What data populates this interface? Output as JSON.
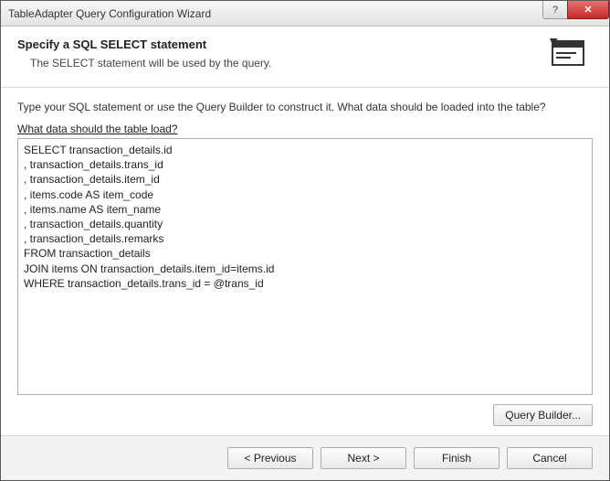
{
  "titlebar": {
    "title": "TableAdapter Query Configuration Wizard",
    "help_glyph": "?",
    "close_glyph": "✕"
  },
  "header": {
    "title": "Specify a SQL SELECT statement",
    "subtitle": "The SELECT statement will be used by the query."
  },
  "body": {
    "instruction": "Type your SQL statement or use the Query Builder to construct it. What data should be loaded into the table?",
    "field_label": "What data should the table load?",
    "sql_text": "SELECT transaction_details.id\n, transaction_details.trans_id\n, transaction_details.item_id\n, items.code AS item_code\n, items.name AS item_name\n, transaction_details.quantity\n, transaction_details.remarks\nFROM transaction_details\nJOIN items ON transaction_details.item_id=items.id\nWHERE transaction_details.trans_id = @trans_id",
    "query_builder": "Query Builder..."
  },
  "footer": {
    "previous": "< Previous",
    "next": "Next >",
    "finish": "Finish",
    "cancel": "Cancel"
  }
}
